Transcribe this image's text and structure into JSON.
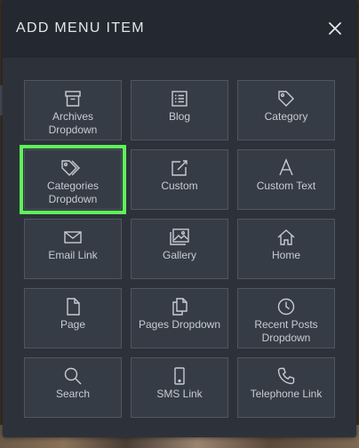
{
  "modal": {
    "title": "ADD MENU ITEM",
    "close_icon": "close-icon"
  },
  "items": [
    {
      "label": "Archives\nDropdown",
      "icon": "archive-box-icon"
    },
    {
      "label": "Blog",
      "icon": "list-document-icon"
    },
    {
      "label": "Category",
      "icon": "tag-icon"
    },
    {
      "label": "Categories\nDropdown",
      "icon": "tags-icon",
      "selected": true
    },
    {
      "label": "Custom",
      "icon": "edit-square-icon"
    },
    {
      "label": "Custom Text",
      "icon": "letter-a-icon"
    },
    {
      "label": "Email Link",
      "icon": "envelope-icon"
    },
    {
      "label": "Gallery",
      "icon": "images-icon"
    },
    {
      "label": "Home",
      "icon": "home-icon"
    },
    {
      "label": "Page",
      "icon": "document-icon"
    },
    {
      "label": "Pages Dropdown",
      "icon": "copy-documents-icon"
    },
    {
      "label": "Recent Posts\nDropdown",
      "icon": "clock-icon"
    },
    {
      "label": "Search",
      "icon": "magnifier-icon"
    },
    {
      "label": "SMS Link",
      "icon": "mobile-phone-icon"
    },
    {
      "label": "Telephone Link",
      "icon": "telephone-icon"
    }
  ],
  "colors": {
    "modal_bg": "#2d323a",
    "header_bg": "#242830",
    "tile_bg": "#363c45",
    "tile_border": "#4f5661",
    "text": "#c7ccd3",
    "selection_outline": "#5ef35a"
  }
}
